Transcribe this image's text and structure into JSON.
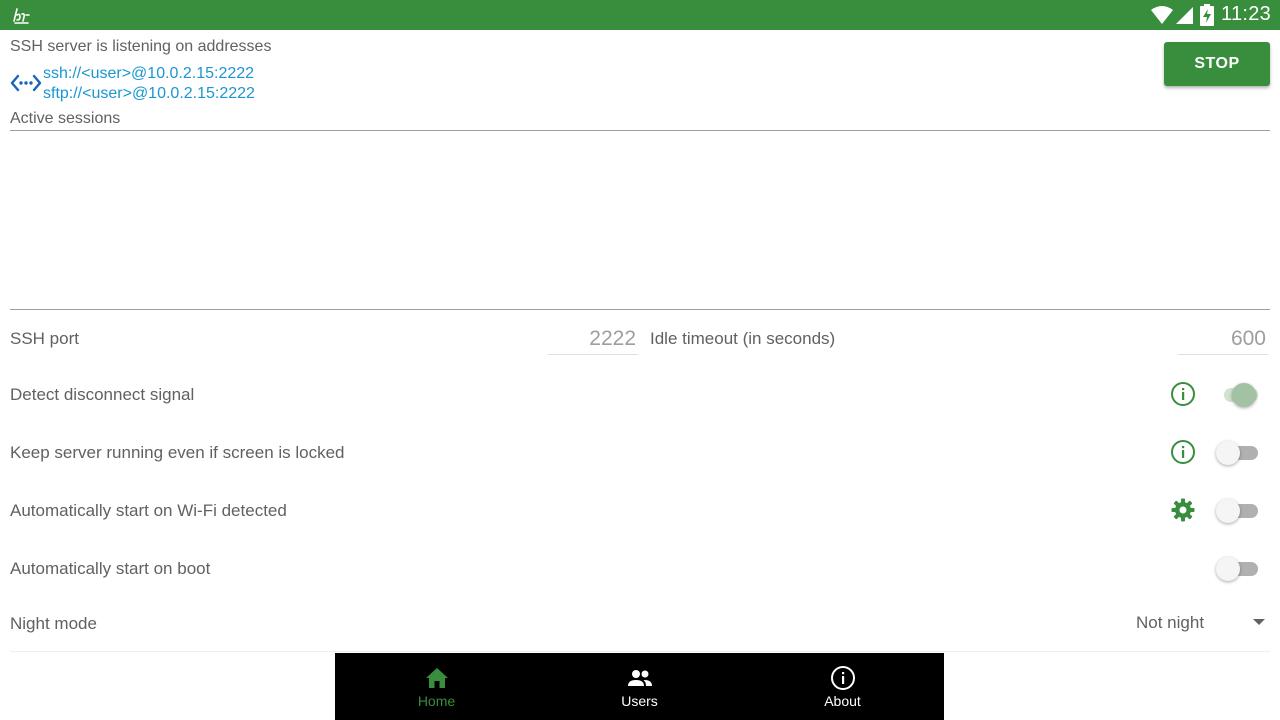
{
  "status_bar": {
    "time": "11:23",
    "icons": [
      "app-logo-icon",
      "wifi-icon",
      "signal-icon",
      "battery-charging-icon"
    ]
  },
  "server": {
    "listening_label": "SSH server is listening on addresses",
    "addresses": [
      "ssh://<user>@10.0.2.15:2222",
      "sftp://<user>@10.0.2.15:2222"
    ],
    "stop_label": "STOP"
  },
  "sessions": {
    "label": "Active sessions",
    "items": []
  },
  "settings": {
    "ssh_port": {
      "label": "SSH port",
      "value": "2222"
    },
    "idle_timeout": {
      "label": "Idle timeout (in seconds)",
      "value": "600"
    },
    "options": [
      {
        "label": "Detect disconnect signal",
        "icon": "info-icon",
        "enabled": true
      },
      {
        "label": "Keep server running even if screen is locked",
        "icon": "info-icon",
        "enabled": false
      },
      {
        "label": "Automatically start on Wi-Fi detected",
        "icon": "gear-icon",
        "enabled": false
      },
      {
        "label": "Automatically start on boot",
        "icon": "",
        "enabled": false
      }
    ],
    "night_mode": {
      "label": "Night mode",
      "value": "Not night"
    }
  },
  "bottom_nav": {
    "items": [
      {
        "label": "Home",
        "icon": "home-icon",
        "active": true
      },
      {
        "label": "Users",
        "icon": "users-icon",
        "active": false
      },
      {
        "label": "About",
        "icon": "info-icon",
        "active": false
      }
    ]
  },
  "colors": {
    "primary": "#388e3c",
    "link": "#1a96d2",
    "text": "#616161",
    "nav_background": "#000000"
  }
}
